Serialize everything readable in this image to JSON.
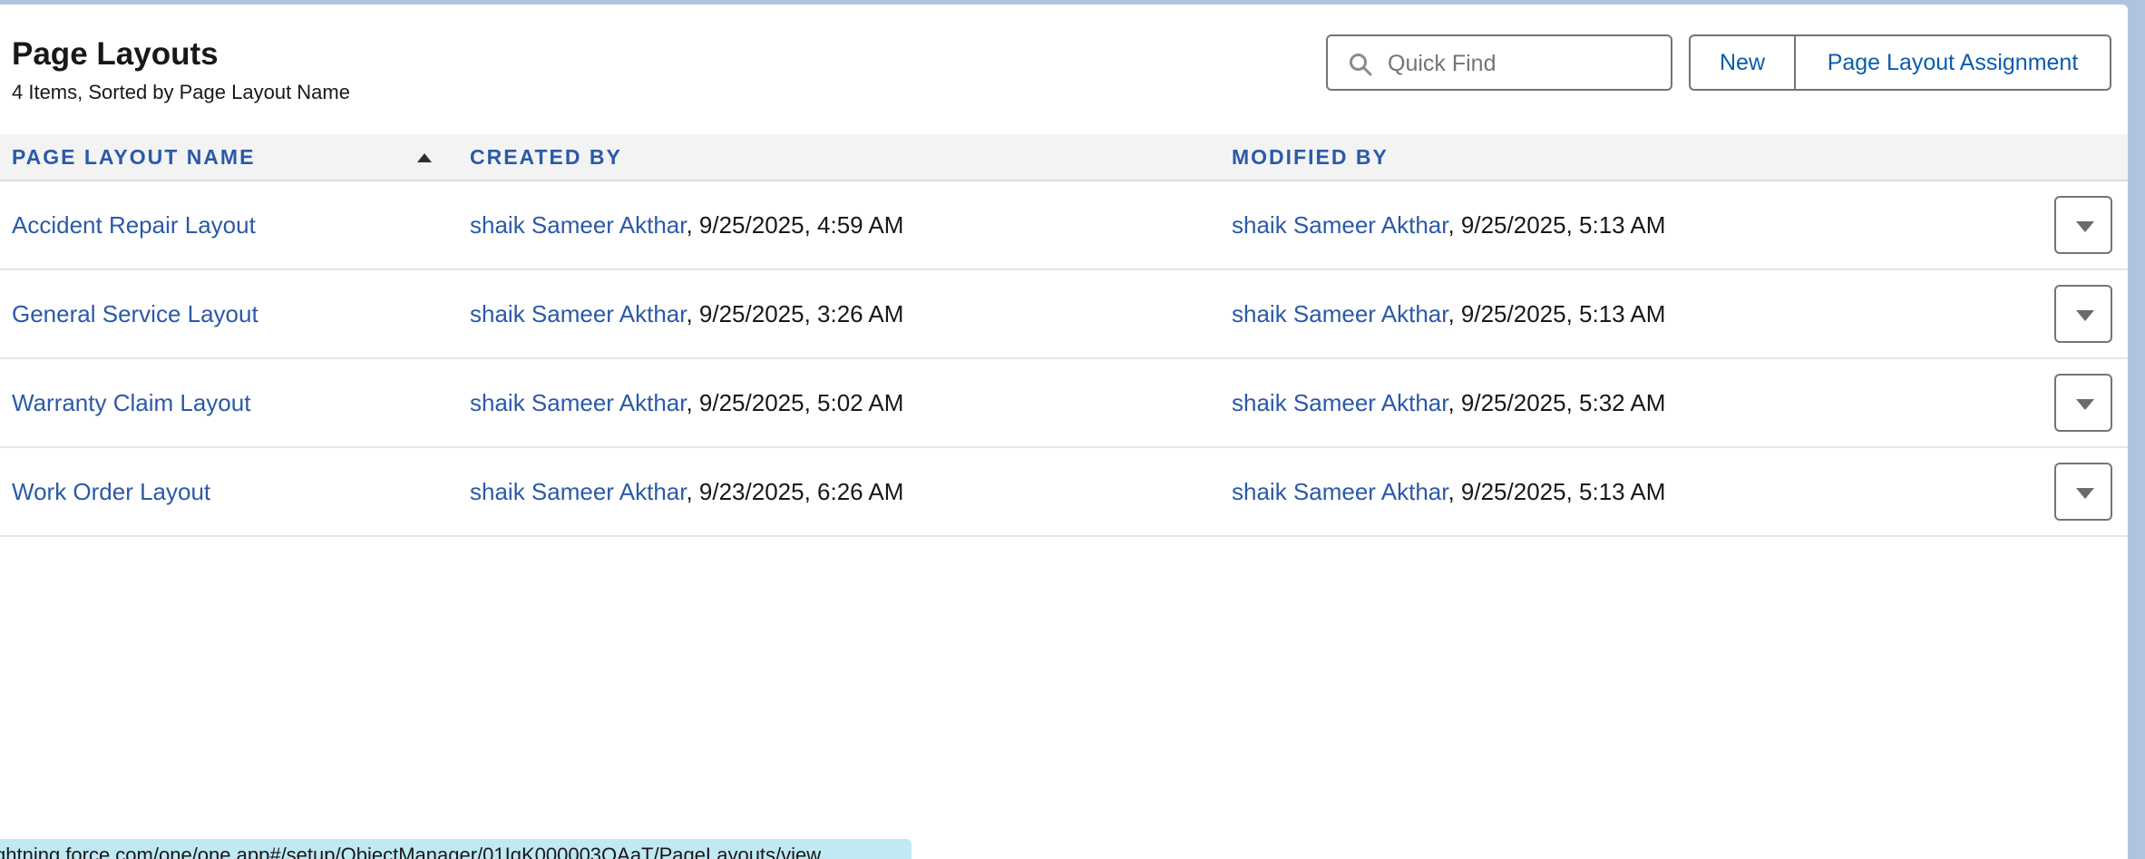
{
  "header": {
    "title": "Page Layouts",
    "subtitle": "4 Items, Sorted by Page Layout Name"
  },
  "search": {
    "placeholder": "Quick Find",
    "icon": "search-icon"
  },
  "buttons": {
    "new_label": "New",
    "assignment_label": "Page Layout Assignment"
  },
  "table": {
    "columns": [
      "PAGE LAYOUT NAME",
      "CREATED BY",
      "MODIFIED BY"
    ],
    "sort": "ascending",
    "rows": [
      {
        "name": "Accident Repair Layout",
        "created_user": "shaik Sameer Akthar",
        "created_date": ", 9/25/2025, 4:59 AM",
        "modified_user": "shaik Sameer Akthar",
        "modified_date": ", 9/25/2025, 5:13 AM"
      },
      {
        "name": "General Service Layout",
        "created_user": "shaik Sameer Akthar",
        "created_date": ", 9/25/2025, 3:26 AM",
        "modified_user": "shaik Sameer Akthar",
        "modified_date": ", 9/25/2025, 5:13 AM"
      },
      {
        "name": "Warranty Claim Layout",
        "created_user": "shaik Sameer Akthar",
        "created_date": ", 9/25/2025, 5:02 AM",
        "modified_user": "shaik Sameer Akthar",
        "modified_date": ", 9/25/2025, 5:32 AM"
      },
      {
        "name": "Work Order Layout",
        "created_user": "shaik Sameer Akthar",
        "created_date": ", 9/23/2025, 6:26 AM",
        "modified_user": "shaik Sameer Akthar",
        "modified_date": ", 9/25/2025, 5:13 AM"
      }
    ]
  },
  "status_bar": {
    "url": "ghtning.force.com/one/one.app#/setup/ObjectManager/01IgK000003QAaT/PageLayouts/view"
  },
  "colors": {
    "link": "#2b59a8",
    "header_bg": "#f3f3f3",
    "status_bar_bg": "#bfe9f3"
  }
}
